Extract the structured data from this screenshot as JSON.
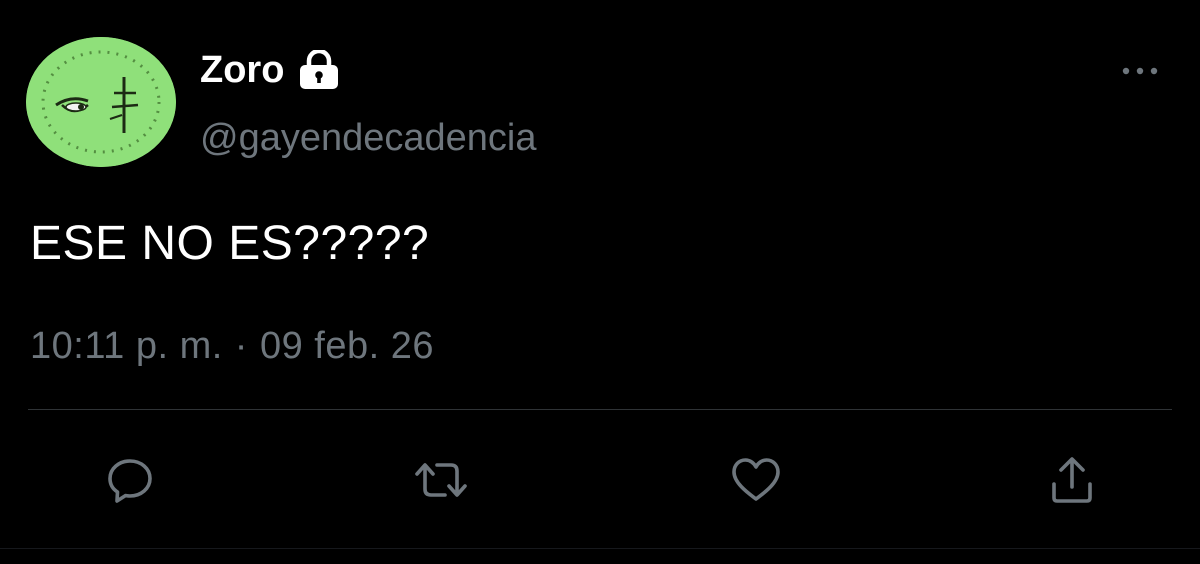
{
  "tweet": {
    "display_name": "Zoro",
    "handle": "@gayendecadencia",
    "text": "ESE NO ES?????",
    "time": "10:11 p. m.",
    "separator": "·",
    "date": "09 feb. 26"
  },
  "icons": {
    "lock": "lock-icon",
    "more": "more-options-icon",
    "reply": "reply-icon",
    "retweet": "retweet-icon",
    "like": "like-icon",
    "share": "share-icon"
  },
  "colors": {
    "background": "#000000",
    "primary_text": "#ffffff",
    "secondary_text": "#6e767d",
    "divider": "#2f3336",
    "avatar_green": "#8fe07a"
  }
}
